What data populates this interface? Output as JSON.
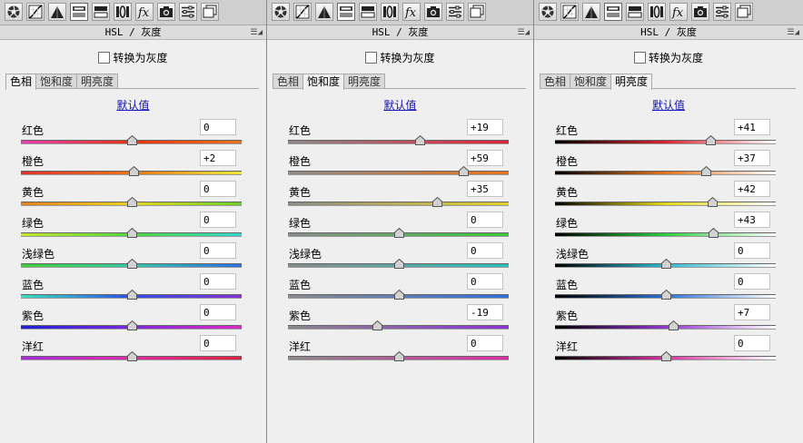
{
  "header_title": "HSL / 灰度",
  "convert_label": "转换为灰度",
  "default_label": "默认值",
  "tabs": [
    "色相",
    "饱和度",
    "明亮度"
  ],
  "colors": [
    "红色",
    "橙色",
    "黄色",
    "绿色",
    "浅绿色",
    "蓝色",
    "紫色",
    "洋红"
  ],
  "toolbar_icons": [
    "aperture-icon",
    "curve-icon",
    "mountain-icon",
    "hsl-icon",
    "split-tone-icon",
    "lens-icon",
    "fx-icon",
    "camera-icon",
    "presets-icon",
    "snapshots-icon"
  ],
  "panels": [
    {
      "active_tab": 0,
      "values": [
        "0",
        "+2",
        "0",
        "0",
        "0",
        "0",
        "0",
        "0"
      ]
    },
    {
      "active_tab": 1,
      "values": [
        "+19",
        "+59",
        "+35",
        "0",
        "0",
        "0",
        "-19",
        "0"
      ]
    },
    {
      "active_tab": 2,
      "values": [
        "+41",
        "+37",
        "+42",
        "+43",
        "0",
        "0",
        "+7",
        "0"
      ]
    }
  ],
  "track_colors": {
    "hue": [
      [
        "#e43fb2",
        "#e8320f",
        "#e8741a"
      ],
      [
        "#e0302a",
        "#e8741a",
        "#eaea34"
      ],
      [
        "#e67f1c",
        "#e8d422",
        "#6ad12a"
      ],
      [
        "#c6e52c",
        "#4ed83b",
        "#35d5cf"
      ],
      [
        "#3fcf3a",
        "#35c7a6",
        "#2f6ee5"
      ],
      [
        "#3ae0bf",
        "#2d50e8",
        "#8a30d9"
      ],
      [
        "#1e22d8",
        "#7c28e0",
        "#df2ac9"
      ],
      [
        "#a72ae0",
        "#e02aa6",
        "#e0203b"
      ]
    ],
    "saturation_gray": "#8a8a8a",
    "saturation_full": [
      "#e5203a",
      "#e6721c",
      "#e3d12a",
      "#3cc93b",
      "#29c1bc",
      "#2f70dd",
      "#8d32d9",
      "#e02aa8"
    ],
    "luminance_mid": [
      "#d7232f",
      "#e07321",
      "#e2d81d",
      "#2fcf43",
      "#2ebbd3",
      "#2b73d8",
      "#9634d6",
      "#dc31a4"
    ]
  }
}
